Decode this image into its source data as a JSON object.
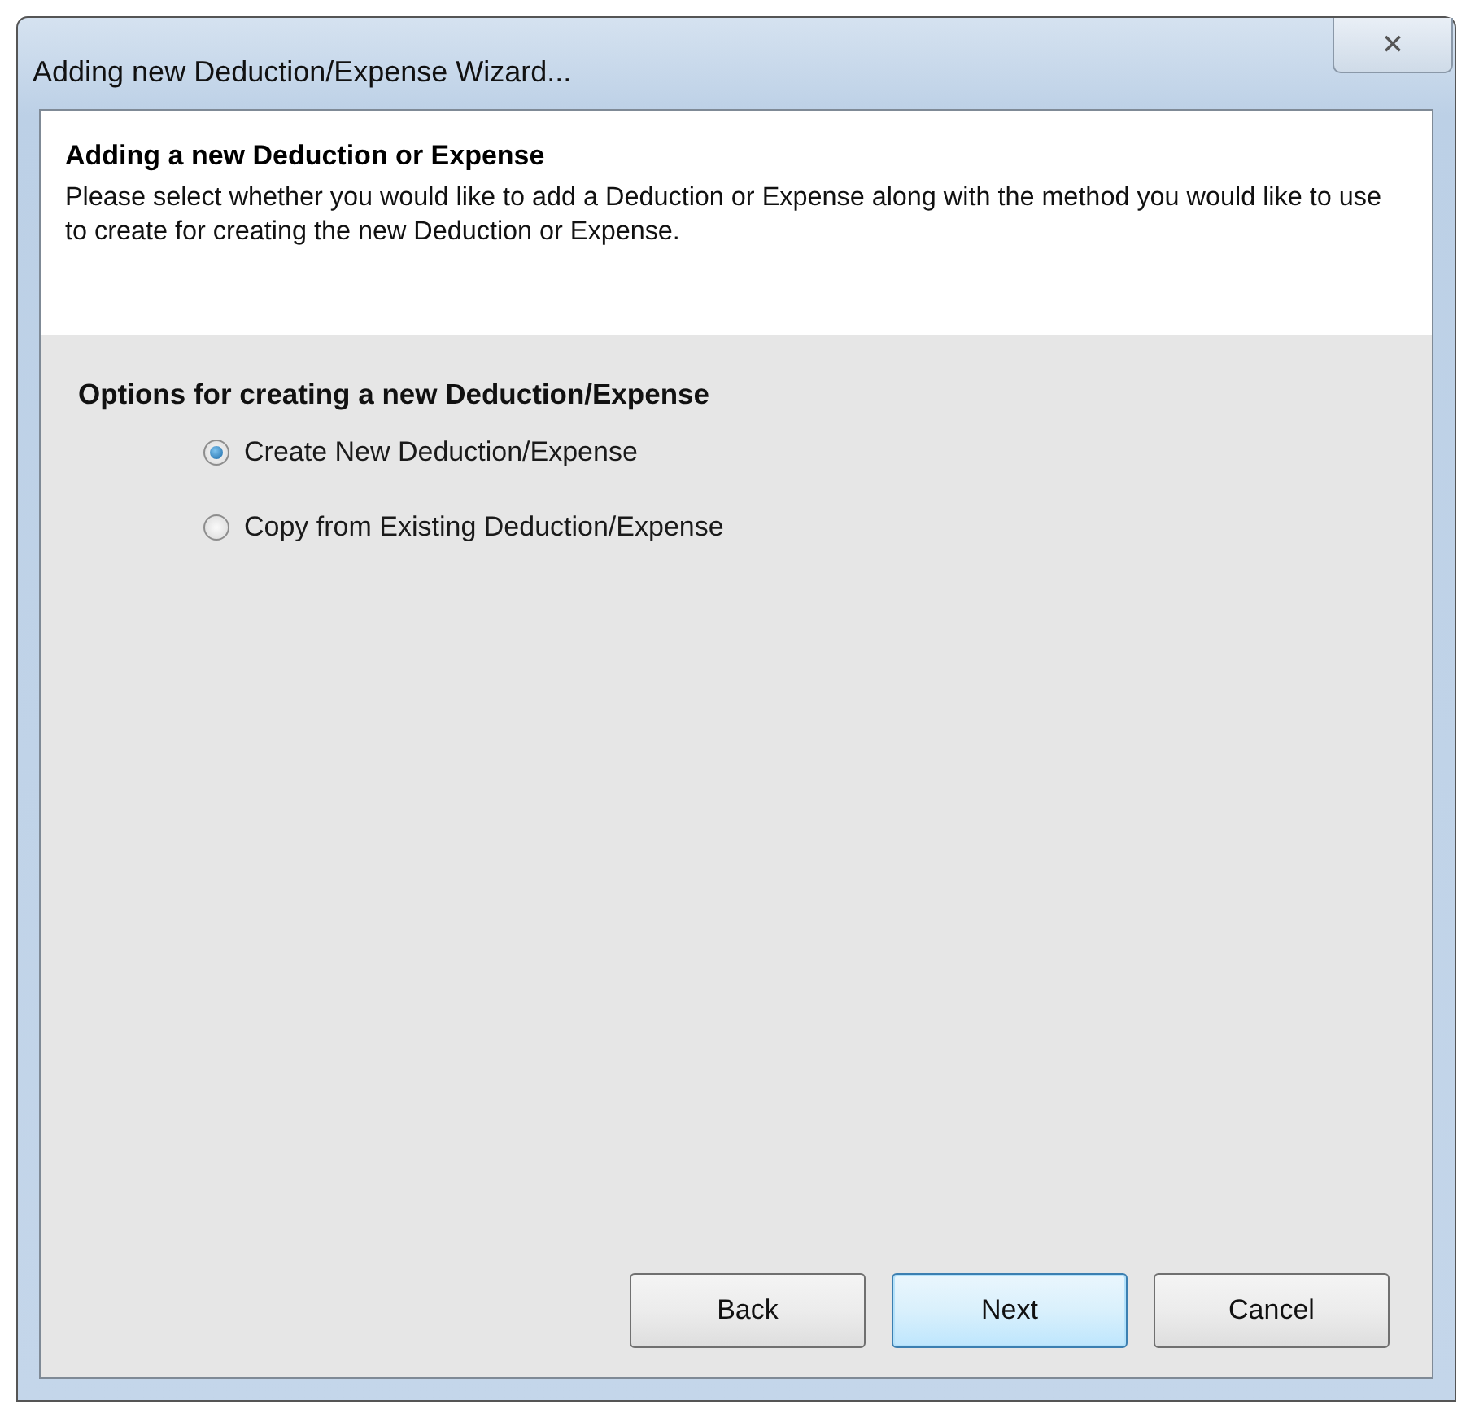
{
  "window": {
    "title": "Adding new Deduction/Expense Wizard...",
    "close_icon": "✕"
  },
  "header": {
    "title": "Adding a new Deduction or Expense",
    "description": "Please select whether you would like to add a Deduction or Expense along with the method you would like to use to create for creating the new Deduction or Expense."
  },
  "options": {
    "title": "Options for creating a new Deduction/Expense",
    "items": [
      {
        "label": "Create New Deduction/Expense",
        "selected": true
      },
      {
        "label": "Copy from Existing Deduction/Expense",
        "selected": false
      }
    ]
  },
  "buttons": [
    {
      "label": "Back",
      "default": false
    },
    {
      "label": "Next",
      "default": true
    },
    {
      "label": "Cancel",
      "default": false
    }
  ]
}
